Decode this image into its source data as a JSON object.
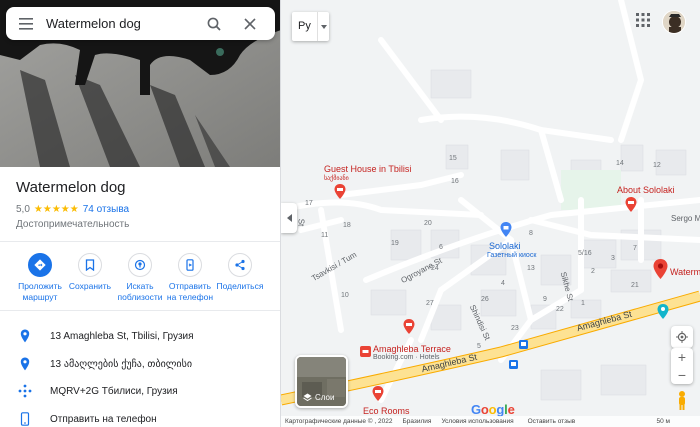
{
  "search": {
    "value": "Watermelon dog"
  },
  "place": {
    "title": "Watermelon dog",
    "rating": "5,0",
    "stars": "★★★★★",
    "reviews": "74 отзыва",
    "category": "Достопримечательность"
  },
  "actions": [
    {
      "label_line1": "Проложить",
      "label_line2": "маршрут",
      "icon": "directions-icon"
    },
    {
      "label_line1": "Сохранить",
      "label_line2": "",
      "icon": "bookmark-icon"
    },
    {
      "label_line1": "Искать",
      "label_line2": "поблизости",
      "icon": "nearby-icon"
    },
    {
      "label_line1": "Отправить",
      "label_line2": "на телефон",
      "icon": "send-to-phone-icon"
    },
    {
      "label_line1": "Поделиться",
      "label_line2": "",
      "icon": "share-icon"
    }
  ],
  "info": {
    "address": "13 Amaghleba St, Tbilisi, Грузия",
    "address_local": "13 ამაღლების ქუჩა, თბილისი",
    "plus_code": "MQRV+2G Тбилиси, Грузия",
    "send_to_phone": "Отправить на телефон"
  },
  "map": {
    "lang_select": "Ру",
    "layers_label": "Слои",
    "pois": {
      "guest_house": "Guest House in Tbilisi",
      "guest_house_local": "საქმიანი",
      "about_sololaki": "About Sololaki",
      "sololaki": "Sololaki",
      "sololaki_sub": "Газетный киоск",
      "watermelon": "Waterm",
      "amaghleba_terrace": "Amaghleba Terrace",
      "amaghleba_terrace_sub": "Booking.com · Hotels",
      "eco_rooms": "Eco Rooms"
    },
    "streets": {
      "amaghleba_1": "Amaghleba St",
      "amaghleba_2": "Amaghleba St",
      "tsavkisi": "Tsavkisi / Tum",
      "ogroyane": "Ogroyane St",
      "shindisi": "Shindisi St",
      "sikhe": "Sikhe St",
      "sergo": "Sergo M",
      "st_left": "St"
    },
    "numbers": {
      "n15": "15",
      "n16": "16",
      "n17": "17",
      "n18": "18",
      "n19": "19",
      "n20": "20",
      "n24": "24",
      "n21": "21",
      "n22": "22",
      "n23": "23",
      "n26": "26",
      "n27": "27",
      "n14": "14",
      "n12": "12",
      "n13": "13",
      "n1": "1",
      "n2": "2",
      "n3": "3",
      "n4": "4",
      "n5": "5",
      "n6": "6",
      "n7": "7",
      "n8": "8",
      "n9": "9",
      "n10": "10",
      "n11": "11",
      "n516": "5/16"
    },
    "footer": {
      "data": "Картографические данные © , 2022",
      "country": "Бразилия",
      "terms": "Условия использования",
      "feedback": "Оставить отзыв",
      "scale": "50 м"
    },
    "logo": "Google"
  },
  "colors": {
    "accent": "#1a73e8",
    "star": "#fbbc04",
    "poi_red": "#ea4335",
    "road_major": "#fde293",
    "map_bg": "#f1f3f4"
  }
}
